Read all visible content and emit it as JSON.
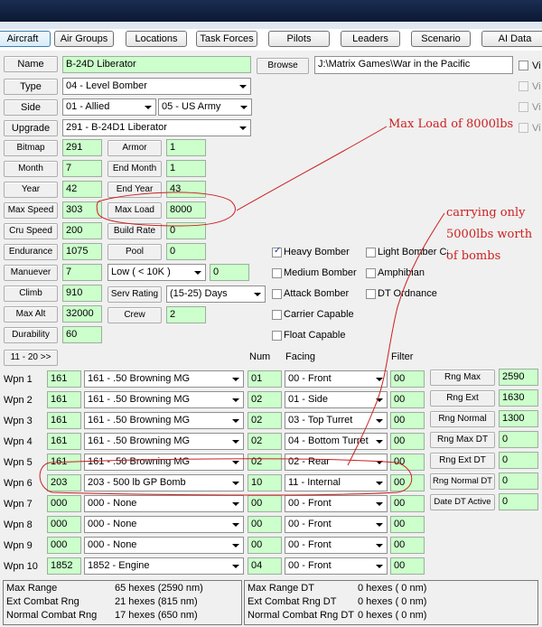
{
  "tabs": [
    {
      "label": "Aircraft",
      "active": true
    },
    {
      "label": "Air Groups"
    },
    {
      "label": "Locations"
    },
    {
      "label": "Task Forces"
    },
    {
      "label": "Pilots"
    },
    {
      "label": "Leaders"
    },
    {
      "label": "Scenario"
    },
    {
      "label": "AI Data"
    }
  ],
  "buttons": {
    "name": "Name",
    "browse": "Browse",
    "type": "Type",
    "side": "Side",
    "upgrade": "Upgrade",
    "bitmap": "Bitmap",
    "armor": "Armor",
    "month": "Month",
    "end_month": "End Month",
    "year": "Year",
    "end_year": "End Year",
    "max_speed": "Max Speed",
    "max_load": "Max Load",
    "cru_speed": "Cru Speed",
    "build_rate": "Build Rate",
    "endurance": "Endurance",
    "pool": "Pool",
    "manuever": "Manuever",
    "climb": "Climb",
    "serv_rating": "Serv Rating",
    "max_alt": "Max Alt",
    "crew": "Crew",
    "durability": "Durability",
    "page": "11 - 20 >>",
    "rng_max": "Rng Max",
    "rng_ext": "Rng Ext",
    "rng_normal": "Rng Normal",
    "rng_max_dt": "Rng Max DT",
    "rng_ext_dt": "Rng Ext DT",
    "rng_normal_dt": "Rng Normal DT",
    "date_dt_active": "Date DT Active"
  },
  "values": {
    "name": "B-24D Liberator",
    "path": "J:\\Matrix Games\\War in the Pacific",
    "type": "04 - Level Bomber",
    "side": "01 - Allied",
    "service": "05 - US Army",
    "upgrade": "291 - B-24D1 Liberator",
    "bitmap": "291",
    "armor": "1",
    "month": "7",
    "end_month": "1",
    "year": "42",
    "end_year": "43",
    "max_speed": "303",
    "max_load": "8000",
    "cru_speed": "200",
    "build_rate": "0",
    "endurance": "1075",
    "pool": "0",
    "manuever": "7",
    "alt_band": "Low     ( < 10K )",
    "alt_band_value": "0",
    "climb": "910",
    "serv_rating": "(15-25) Days",
    "max_alt": "32000",
    "crew": "2",
    "durability": "60",
    "rng_max": "2590",
    "rng_ext": "1630",
    "rng_normal": "1300",
    "rng_max_dt": "0",
    "rng_ext_dt": "0",
    "rng_normal_dt": "0",
    "date_dt_active": "0"
  },
  "right_checks": [
    {
      "label": "Vi",
      "checked": false,
      "disabled": false
    },
    {
      "label": "Vi",
      "checked": false,
      "disabled": true
    },
    {
      "label": "Vi",
      "checked": false,
      "disabled": true
    },
    {
      "label": "Vi",
      "checked": false,
      "disabled": true
    }
  ],
  "checks_col1": [
    {
      "label": "Heavy Bomber",
      "checked": true
    },
    {
      "label": "Medium Bomber",
      "checked": false
    },
    {
      "label": "Attack Bomber",
      "checked": false
    },
    {
      "label": "Carrier Capable",
      "checked": false
    },
    {
      "label": "Float Capable",
      "checked": false
    }
  ],
  "checks_col2": [
    {
      "label": "Light Bomber Cap",
      "checked": false
    },
    {
      "label": "Amphibian",
      "checked": false
    },
    {
      "label": "DT Ordnance",
      "checked": false
    }
  ],
  "weapon_headers": {
    "num": "Num",
    "facing": "Facing",
    "filter": "Filter"
  },
  "weapons": [
    {
      "label": "Wpn 1",
      "id": "161",
      "name": "161 - .50 Browning MG",
      "num": "01",
      "facing": "00 - Front",
      "filter": "00"
    },
    {
      "label": "Wpn 2",
      "id": "161",
      "name": "161 - .50 Browning MG",
      "num": "02",
      "facing": "01 - Side",
      "filter": "00"
    },
    {
      "label": "Wpn 3",
      "id": "161",
      "name": "161 - .50 Browning MG",
      "num": "02",
      "facing": "03 - Top Turret",
      "filter": "00"
    },
    {
      "label": "Wpn 4",
      "id": "161",
      "name": "161 - .50 Browning MG",
      "num": "02",
      "facing": "04 - Bottom Turret",
      "filter": "00"
    },
    {
      "label": "Wpn 5",
      "id": "161",
      "name": "161 - .50 Browning MG",
      "num": "02",
      "facing": "02 - Rear",
      "filter": "00"
    },
    {
      "label": "Wpn 6",
      "id": "203",
      "name": "203 - 500 lb GP Bomb",
      "num": "10",
      "facing": "11 - Internal",
      "filter": "00"
    },
    {
      "label": "Wpn 7",
      "id": "000",
      "name": "000 - None",
      "num": "00",
      "facing": "00 - Front",
      "filter": "00"
    },
    {
      "label": "Wpn 8",
      "id": "000",
      "name": "000 - None",
      "num": "00",
      "facing": "00 - Front",
      "filter": "00"
    },
    {
      "label": "Wpn 9",
      "id": "000",
      "name": "000 - None",
      "num": "00",
      "facing": "00 - Front",
      "filter": "00"
    },
    {
      "label": "Wpn 10",
      "id": "1852",
      "name": "1852 - Engine",
      "num": "04",
      "facing": "00 - Front",
      "filter": "00"
    }
  ],
  "summary_left": [
    {
      "label": "Max Range",
      "value": "65 hexes (2590 nm)"
    },
    {
      "label": "Ext Combat Rng",
      "value": "21 hexes (815 nm)"
    },
    {
      "label": "Normal Combat Rng",
      "value": "17 hexes (650 nm)"
    }
  ],
  "summary_right": [
    {
      "label": "Max Range DT",
      "value": "0 hexes ( 0 nm)"
    },
    {
      "label": "Ext Combat Rng DT",
      "value": "0 hexes ( 0 nm)"
    },
    {
      "label": "Normal Combat Rng DT",
      "value": "0 hexes ( 0 nm)"
    }
  ],
  "annotations": {
    "max_load_note": "Max Load of 8000lbs",
    "carry_note_1": "carrying only",
    "carry_note_2": "5000lbs worth",
    "carry_note_3": "of bombs"
  },
  "colors": {
    "field": "#ccffcc",
    "annotation": "#cc1f1f",
    "titlebar": "#0b1833"
  }
}
